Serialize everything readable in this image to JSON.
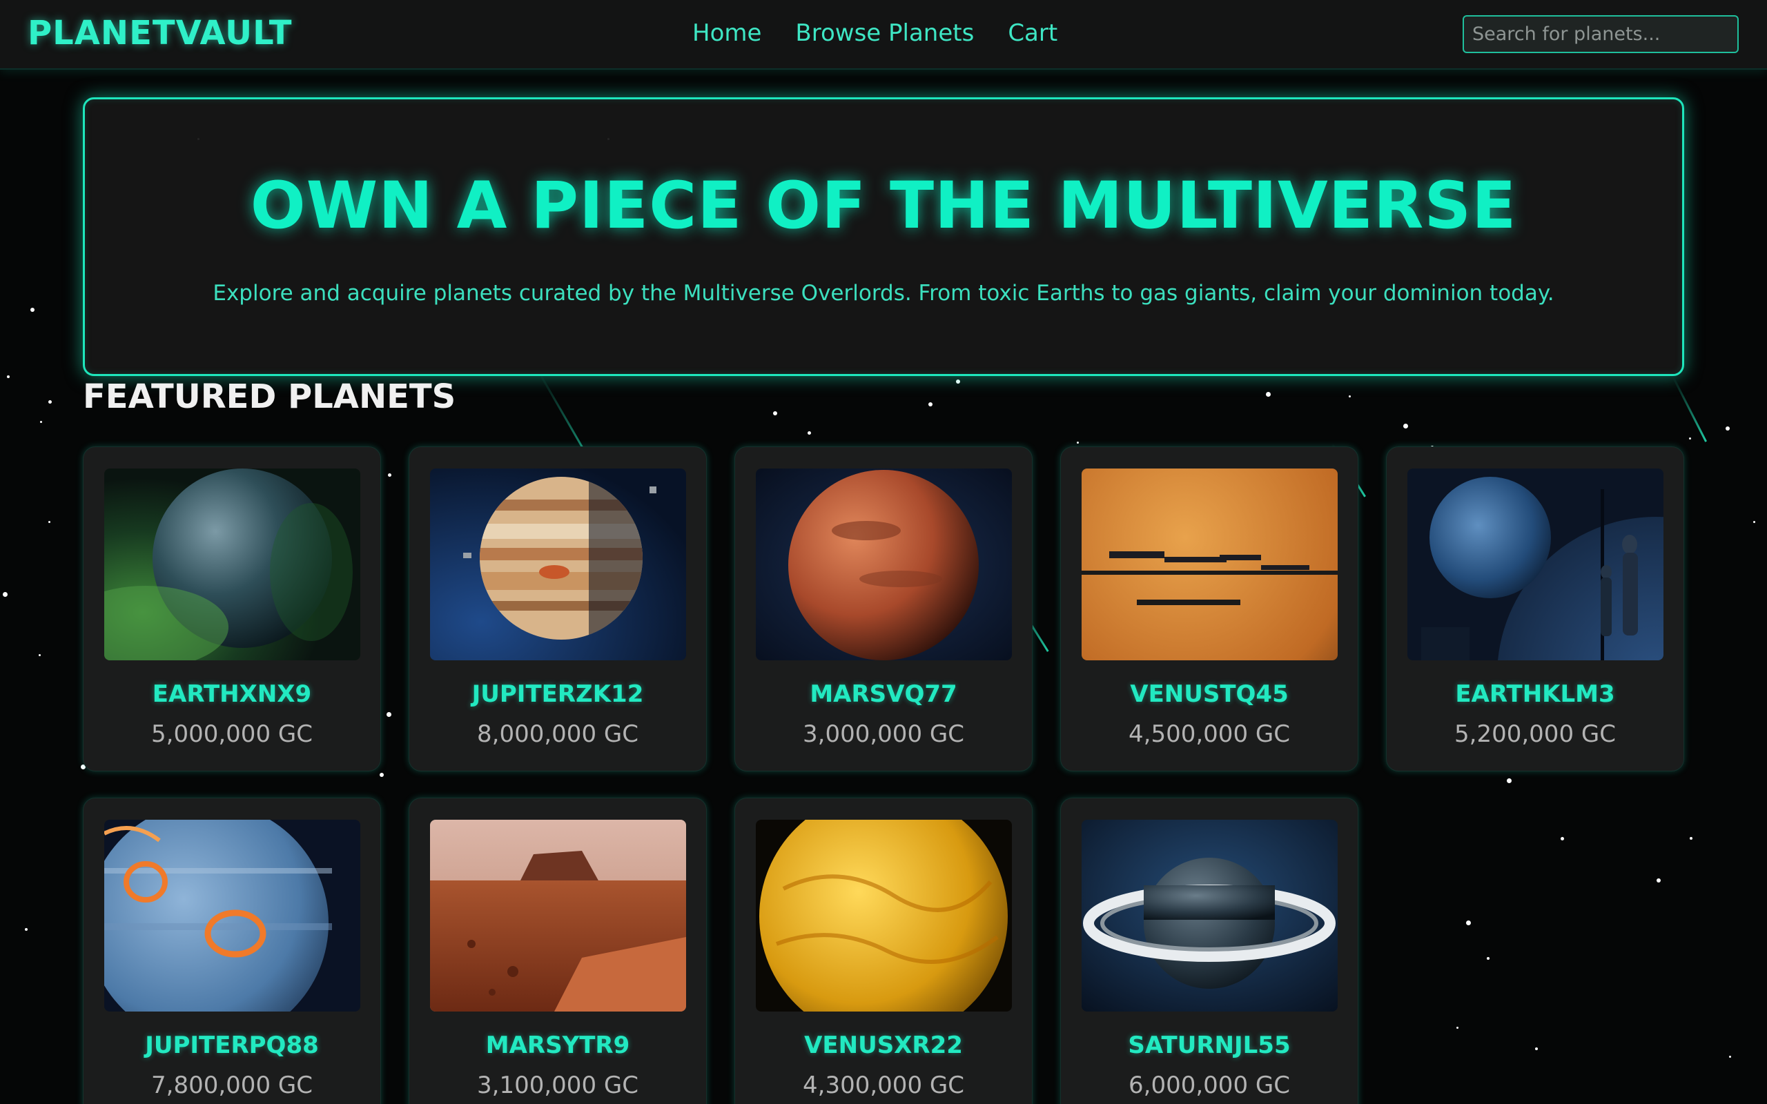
{
  "header": {
    "logo": "PLANETVAULT",
    "nav": [
      "Home",
      "Browse Planets",
      "Cart"
    ],
    "search_placeholder": "Search for planets..."
  },
  "hero": {
    "title": "OWN A PIECE OF THE MULTIVERSE",
    "subtitle": "Explore and acquire planets curated by the Multiverse Overlords. From toxic Earths to gas giants, claim your dominion today."
  },
  "featured": {
    "title": "FEATURED PLANETS",
    "planets": [
      {
        "name": "EARTHXNX9",
        "price": "5,000,000 GC",
        "image": "toxic-earth-icon"
      },
      {
        "name": "JUPITERZK12",
        "price": "8,000,000 GC",
        "image": "jupiter-icon"
      },
      {
        "name": "MARSVQ77",
        "price": "3,000,000 GC",
        "image": "mars-icon"
      },
      {
        "name": "VENUSTQ45",
        "price": "4,500,000 GC",
        "image": "venus-ships-icon"
      },
      {
        "name": "EARTHKLM3",
        "price": "5,200,000 GC",
        "image": "earth-observatory-icon"
      },
      {
        "name": "JUPITERPQ88",
        "price": "7,800,000 GC",
        "image": "jupiter-storm-icon"
      },
      {
        "name": "MARSYTR9",
        "price": "3,100,000 GC",
        "image": "mars-surface-icon"
      },
      {
        "name": "VENUSXR22",
        "price": "4,300,000 GC",
        "image": "venus-globe-icon"
      },
      {
        "name": "SATURNJL55",
        "price": "6,000,000 GC",
        "image": "saturn-icon"
      }
    ]
  },
  "colors": {
    "accent": "#10f0c4",
    "background": "#050606",
    "card": "#1b1c1c"
  }
}
